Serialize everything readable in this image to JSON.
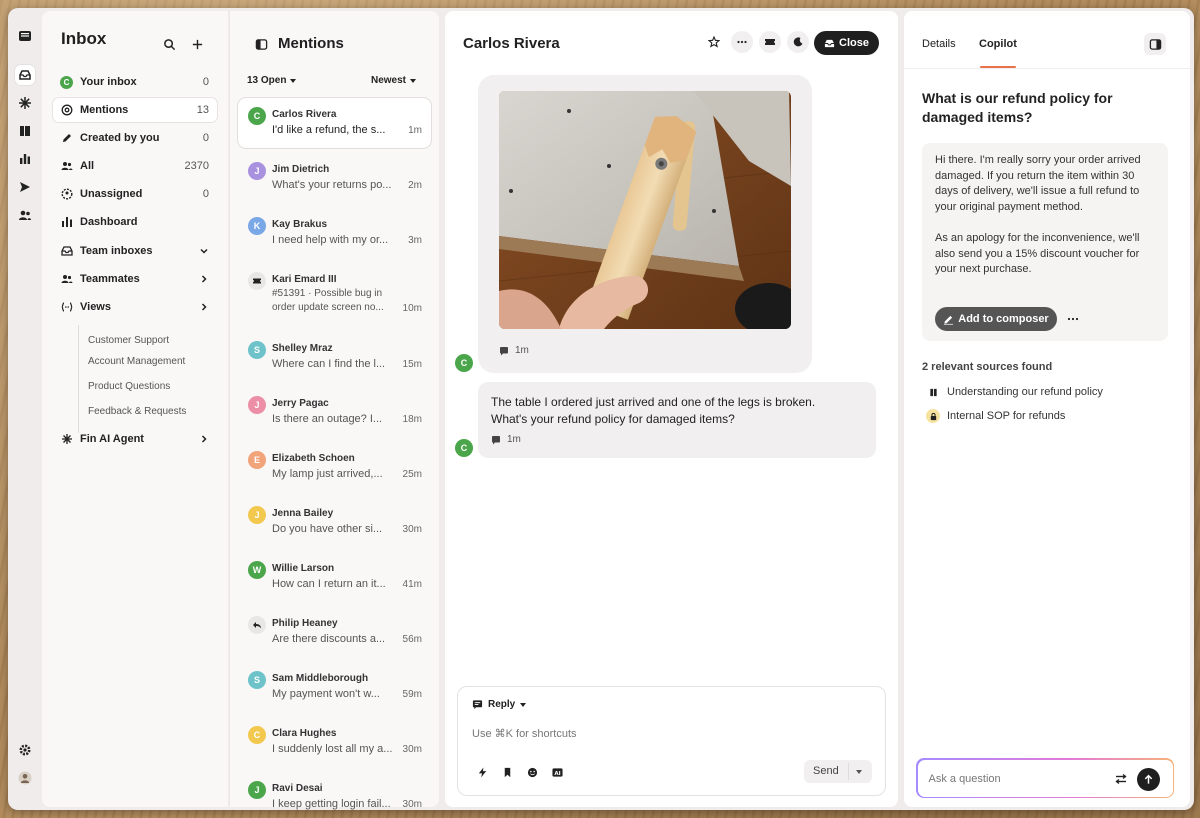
{
  "colors": {
    "accent": "#e8734a",
    "primary_dark": "#1f1f1f",
    "avatar_green": "#4ba64b"
  },
  "rail": {
    "icons": [
      "inbox-app-icon",
      "inbox-icon",
      "fin-icon",
      "book-icon",
      "reports-icon",
      "outbound-icon",
      "contacts-icon",
      "settings-icon",
      "user-avatar"
    ]
  },
  "nav": {
    "title": "Inbox",
    "items": [
      {
        "label": "Your inbox",
        "count": "0"
      },
      {
        "label": "Mentions",
        "count": "13"
      },
      {
        "label": "Created by you",
        "count": "0"
      },
      {
        "label": "All",
        "count": "2370"
      },
      {
        "label": "Unassigned",
        "count": "0"
      },
      {
        "label": "Dashboard",
        "count": ""
      },
      {
        "label": "Team inboxes",
        "count": ""
      },
      {
        "label": "Teammates",
        "count": ""
      },
      {
        "label": "Views",
        "count": ""
      },
      {
        "label": "Fin AI Agent",
        "count": ""
      }
    ],
    "your_inbox_avatar": "C",
    "views": [
      "Customer Support",
      "Account Management",
      "Product Questions",
      "Feedback & Requests"
    ]
  },
  "list": {
    "title": "Mentions",
    "filter_open": "13 Open",
    "sort": "Newest",
    "conversations": [
      {
        "initial": "C",
        "name": "Carlos Rivera",
        "preview": "I'd like a refund, the s...",
        "time": "1m",
        "color": "#4ba64b"
      },
      {
        "initial": "J",
        "name": "Jim Dietrich",
        "preview": "What's your returns po...",
        "time": "2m",
        "color": "#a892e0"
      },
      {
        "initial": "K",
        "name": "Kay Brakus",
        "preview": "I need help with my or...",
        "time": "3m",
        "color": "#7aa7e6"
      },
      {
        "initial": "",
        "name": "Kari Emard III",
        "preview": "#51391 · Possible bug in",
        "preview2": "order update screen no...",
        "time": "10m",
        "color": "#e9e6e6"
      },
      {
        "initial": "S",
        "name": "Shelley Mraz",
        "preview": "Where can I find the l...",
        "time": "15m",
        "color": "#6dc3c9"
      },
      {
        "initial": "J",
        "name": "Jerry Pagac",
        "preview": "Is there an outage? I...",
        "time": "18m",
        "color": "#ec8fa6"
      },
      {
        "initial": "E",
        "name": "Elizabeth Schoen",
        "preview": "My lamp just arrived,...",
        "time": "25m",
        "color": "#f1a37a"
      },
      {
        "initial": "J",
        "name": "Jenna Bailey",
        "preview": "Do you have other si...",
        "time": "30m",
        "color": "#f2c84f"
      },
      {
        "initial": "W",
        "name": "Willie Larson",
        "preview": "How can I return an it...",
        "time": "41m",
        "color": "#4ba64b"
      },
      {
        "initial": "",
        "name": "Philip Heaney",
        "preview": "Are there discounts a...",
        "time": "56m",
        "color": "#e9e6e6"
      },
      {
        "initial": "S",
        "name": "Sam Middleborough",
        "preview": "My payment won't w...",
        "time": "59m",
        "color": "#6dc3c9"
      },
      {
        "initial": "C",
        "name": "Clara Hughes",
        "preview": "I suddenly lost all my a...",
        "time": "30m",
        "color": "#f2c84f"
      },
      {
        "initial": "J",
        "name": "Ravi Desai",
        "preview": "I keep getting login fail...",
        "time": "30m",
        "color": "#4ba64b"
      }
    ]
  },
  "chat": {
    "title": "Carlos Rivera",
    "close_label": "Close",
    "avatar_initial": "C",
    "image_message": {
      "time": "1m"
    },
    "text_message": {
      "line1": "The table I ordered just arrived and one of the legs is broken.",
      "line2": "What's your refund policy for damaged items?",
      "time": "1m"
    },
    "composer": {
      "mode": "Reply",
      "placeholder": "Use ⌘K for shortcuts",
      "send_label": "Send"
    }
  },
  "copilot": {
    "tabs": [
      "Details",
      "Copilot"
    ],
    "active_tab": "Copilot",
    "question_line1": "What is our refund policy for",
    "question_line2": "damaged items?",
    "answer_p1": [
      "Hi there. I'm really sorry your order arrived",
      "damaged. If you return the item within 30",
      "days of delivery, we'll issue a full refund to",
      "your original payment method."
    ],
    "answer_p2": [
      "As an apology for the inconvenience, we'll",
      "also send you a 15% discount voucher for",
      "your next purchase."
    ],
    "add_button": "Add to composer",
    "sources_heading": "2 relevant sources found",
    "sources": [
      "Understanding our refund policy",
      "Internal SOP for refunds"
    ],
    "ask_placeholder": "Ask a question"
  }
}
